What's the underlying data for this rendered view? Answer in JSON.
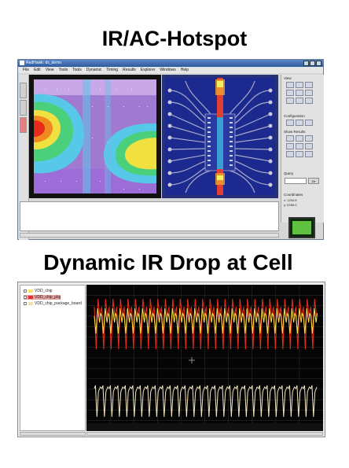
{
  "titles": {
    "top": "IR/AC-Hotspot",
    "bottom": "Dynamic IR Drop at Cell"
  },
  "window1": {
    "title": "RedHawk: ds_demo",
    "menu": [
      "File",
      "Edit",
      "View",
      "Tools",
      "Tools",
      "Dynamic",
      "Timing",
      "Results",
      "Explorer",
      "Windows",
      "Help"
    ],
    "side_sections": [
      "View",
      "Configuration",
      "Show Results",
      "Query",
      "Coordinates"
    ],
    "query_button": "Clr",
    "coords": [
      "x: 1234.5",
      "y: 6789.0"
    ]
  },
  "window2": {
    "tree_items": [
      {
        "label": "VDD_chip",
        "color": "#ffe066"
      },
      {
        "label": "VDD_chip_pkg",
        "color": "#e03030"
      },
      {
        "label": "VDD_chip_package_board",
        "color": "#f0e0b0"
      }
    ],
    "colors": {
      "yellow": "#ffe24a",
      "red": "#e02a1a",
      "cream": "#f3e7c2"
    }
  }
}
